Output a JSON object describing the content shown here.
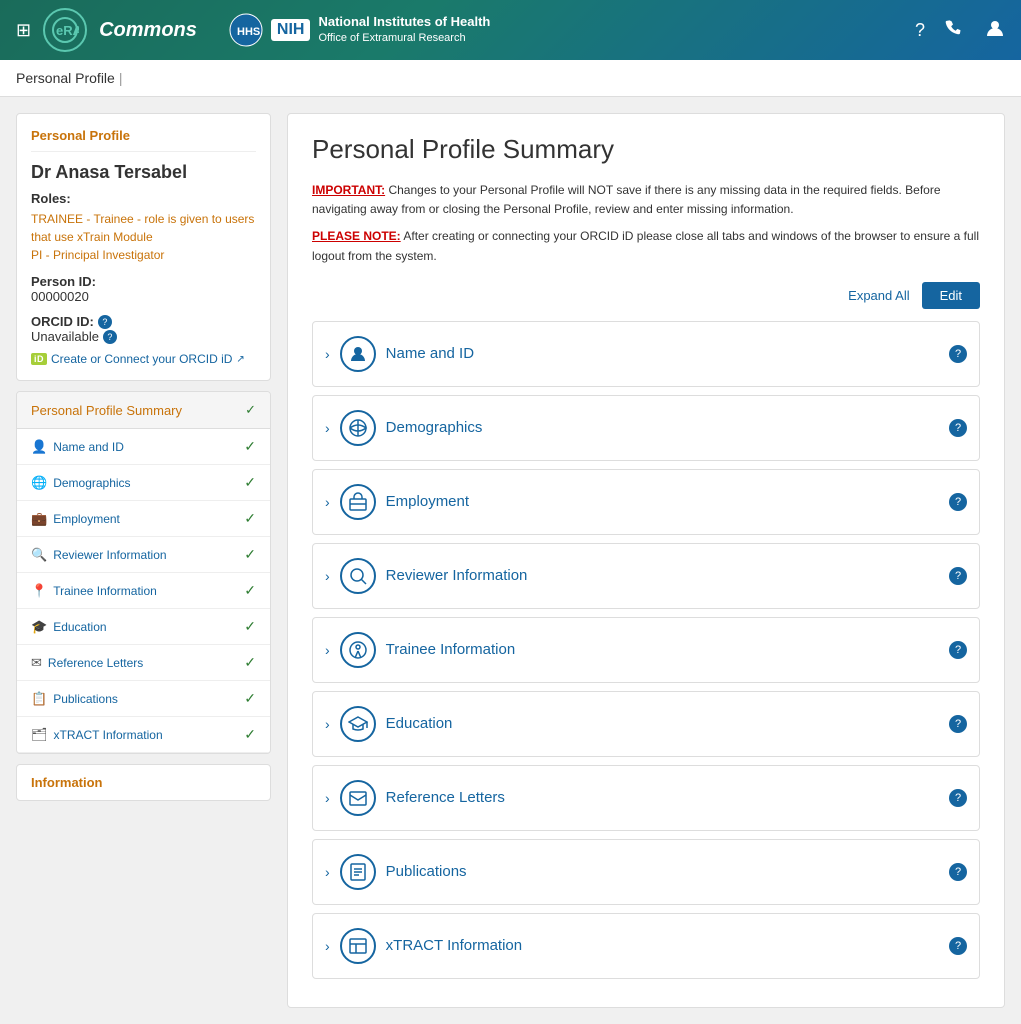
{
  "header": {
    "app_name": "Commons",
    "nih_title": "National Institutes of Health",
    "nih_subtitle": "Office of Extramural Research",
    "nih_badge": "NIH",
    "grid_icon": "⊞",
    "help_icon": "?",
    "phone_icon": "📞",
    "user_icon": "👤"
  },
  "breadcrumb": {
    "label": "Personal Profile",
    "separator": "|"
  },
  "sidebar": {
    "profile_card_title": "Personal Profile",
    "person_name": "Dr Anasa Tersabel",
    "roles_label": "Roles:",
    "roles": [
      "TRAINEE - Trainee - role is given to users that use xTrain Module",
      "PI - Principal Investigator"
    ],
    "person_id_label": "Person ID:",
    "person_id": "00000020",
    "orcid_label": "ORCID ID:",
    "orcid_value": "Unavailable",
    "orcid_link_text": "Create or Connect your ORCID iD",
    "nav_header": "Personal Profile Summary",
    "nav_items": [
      {
        "icon": "👤",
        "label": "Name and ID",
        "checked": true
      },
      {
        "icon": "🌐",
        "label": "Demographics",
        "checked": true
      },
      {
        "icon": "💼",
        "label": "Employment",
        "checked": true
      },
      {
        "icon": "🔍",
        "label": "Reviewer Information",
        "checked": true
      },
      {
        "icon": "📍",
        "label": "Trainee Information",
        "checked": true
      },
      {
        "icon": "🎓",
        "label": "Education",
        "checked": true
      },
      {
        "icon": "✉",
        "label": "Reference Letters",
        "checked": true
      },
      {
        "icon": "📋",
        "label": "Publications",
        "checked": true
      },
      {
        "icon": "🗂",
        "label": "xTRACT Information",
        "checked": true
      }
    ],
    "info_section_title": "Information"
  },
  "content": {
    "title": "Personal Profile Summary",
    "important_label": "IMPORTANT:",
    "important_text": " Changes to your Personal Profile will NOT save if there is any missing data in the required fields. Before navigating away from or closing the Personal Profile, review and enter missing information.",
    "please_note_label": "PLEASE NOTE:",
    "please_note_text": " After creating or connecting your ORCID iD please close all tabs and windows of the browser to ensure a full logout from the system.",
    "expand_all": "Expand All",
    "edit_btn": "Edit",
    "sections": [
      {
        "label": "Name and ID",
        "icon": "👤"
      },
      {
        "label": "Demographics",
        "icon": "🌐"
      },
      {
        "label": "Employment",
        "icon": "💼"
      },
      {
        "label": "Reviewer Information",
        "icon": "🔍"
      },
      {
        "label": "Trainee Information",
        "icon": "📍"
      },
      {
        "label": "Education",
        "icon": "🎓"
      },
      {
        "label": "Reference Letters",
        "icon": "✉"
      },
      {
        "label": "Publications",
        "icon": "📋"
      },
      {
        "label": "xTRACT Information",
        "icon": "🗂"
      }
    ]
  }
}
